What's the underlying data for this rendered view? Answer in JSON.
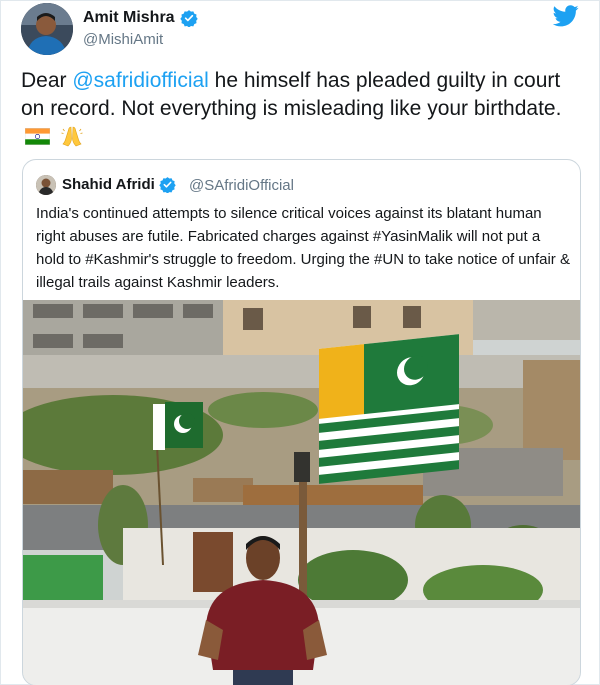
{
  "tweet": {
    "author_name": "Amit Mishra",
    "author_handle": "@MishiAmit",
    "text_prefix": "Dear ",
    "mention": "@safridiofficial",
    "text_suffix": " he himself has pleaded guilty in court on record. Not everything is misleading like your birthdate.",
    "emojis": [
      "india-flag-icon",
      "folded-hands-icon"
    ]
  },
  "quoted_tweet": {
    "author_name": "Shahid Afridi",
    "author_handle": "@SAfridiOfficial",
    "text": "India's continued attempts to silence critical voices against its blatant human right abuses are futile. Fabricated charges against #YasinMalik will not put a hold to #Kashmir's struggle to freedom. Urging the #UN to take notice of unfair & illegal trails against Kashmir leaders."
  },
  "colors": {
    "link_blue": "#1da1f2",
    "verified_blue": "#1da1f2",
    "handle_grey": "#657786",
    "border": "#ccd6dd"
  }
}
